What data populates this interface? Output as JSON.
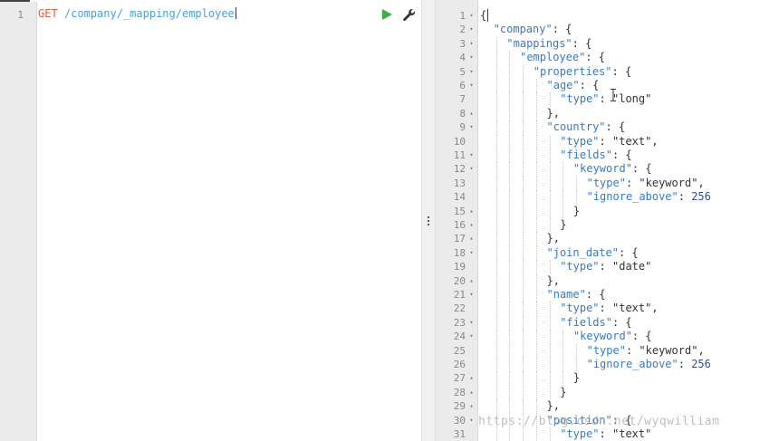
{
  "request": {
    "line_number": "1",
    "method": "GET",
    "path": "/company/_mapping/employee"
  },
  "actions": {
    "run_icon": "play-icon",
    "settings_icon": "wrench-icon"
  },
  "response": {
    "lines": [
      {
        "n": "1",
        "f": "▾",
        "d": 0,
        "parts": [
          [
            "p",
            "{"
          ]
        ]
      },
      {
        "n": "2",
        "f": "▾",
        "d": 1,
        "parts": [
          [
            "k",
            "\"company\""
          ],
          [
            "p",
            ": {"
          ]
        ]
      },
      {
        "n": "3",
        "f": "▾",
        "d": 2,
        "parts": [
          [
            "k",
            "\"mappings\""
          ],
          [
            "p",
            ": {"
          ]
        ]
      },
      {
        "n": "4",
        "f": "▾",
        "d": 3,
        "parts": [
          [
            "k",
            "\"employee\""
          ],
          [
            "p",
            ": {"
          ]
        ]
      },
      {
        "n": "5",
        "f": "▾",
        "d": 4,
        "parts": [
          [
            "k",
            "\"properties\""
          ],
          [
            "p",
            ": {"
          ]
        ]
      },
      {
        "n": "6",
        "f": "▾",
        "d": 5,
        "parts": [
          [
            "k",
            "\"age\""
          ],
          [
            "p",
            ": {"
          ]
        ]
      },
      {
        "n": "7",
        "f": "",
        "d": 6,
        "parts": [
          [
            "k",
            "\"type\""
          ],
          [
            "p",
            ": "
          ],
          [
            "s",
            "\"long\""
          ]
        ]
      },
      {
        "n": "8",
        "f": "▴",
        "d": 5,
        "parts": [
          [
            "p",
            "},"
          ]
        ]
      },
      {
        "n": "9",
        "f": "▾",
        "d": 5,
        "parts": [
          [
            "k",
            "\"country\""
          ],
          [
            "p",
            ": {"
          ]
        ]
      },
      {
        "n": "10",
        "f": "",
        "d": 6,
        "parts": [
          [
            "k",
            "\"type\""
          ],
          [
            "p",
            ": "
          ],
          [
            "s",
            "\"text\""
          ],
          [
            "p",
            ","
          ]
        ]
      },
      {
        "n": "11",
        "f": "▾",
        "d": 6,
        "parts": [
          [
            "k",
            "\"fields\""
          ],
          [
            "p",
            ": {"
          ]
        ]
      },
      {
        "n": "12",
        "f": "▾",
        "d": 7,
        "parts": [
          [
            "k",
            "\"keyword\""
          ],
          [
            "p",
            ": {"
          ]
        ]
      },
      {
        "n": "13",
        "f": "",
        "d": 8,
        "parts": [
          [
            "k",
            "\"type\""
          ],
          [
            "p",
            ": "
          ],
          [
            "s",
            "\"keyword\""
          ],
          [
            "p",
            ","
          ]
        ]
      },
      {
        "n": "14",
        "f": "",
        "d": 8,
        "parts": [
          [
            "k",
            "\"ignore_above\""
          ],
          [
            "p",
            ": "
          ],
          [
            "n",
            "256"
          ]
        ]
      },
      {
        "n": "15",
        "f": "▴",
        "d": 7,
        "parts": [
          [
            "p",
            "}"
          ]
        ]
      },
      {
        "n": "16",
        "f": "▴",
        "d": 6,
        "parts": [
          [
            "p",
            "}"
          ]
        ]
      },
      {
        "n": "17",
        "f": "▴",
        "d": 5,
        "parts": [
          [
            "p",
            "},"
          ]
        ]
      },
      {
        "n": "18",
        "f": "▾",
        "d": 5,
        "parts": [
          [
            "k",
            "\"join_date\""
          ],
          [
            "p",
            ": {"
          ]
        ]
      },
      {
        "n": "19",
        "f": "",
        "d": 6,
        "parts": [
          [
            "k",
            "\"type\""
          ],
          [
            "p",
            ": "
          ],
          [
            "s",
            "\"date\""
          ]
        ]
      },
      {
        "n": "20",
        "f": "▴",
        "d": 5,
        "parts": [
          [
            "p",
            "},"
          ]
        ]
      },
      {
        "n": "21",
        "f": "▾",
        "d": 5,
        "parts": [
          [
            "k",
            "\"name\""
          ],
          [
            "p",
            ": {"
          ]
        ]
      },
      {
        "n": "22",
        "f": "",
        "d": 6,
        "parts": [
          [
            "k",
            "\"type\""
          ],
          [
            "p",
            ": "
          ],
          [
            "s",
            "\"text\""
          ],
          [
            "p",
            ","
          ]
        ]
      },
      {
        "n": "23",
        "f": "▾",
        "d": 6,
        "parts": [
          [
            "k",
            "\"fields\""
          ],
          [
            "p",
            ": {"
          ]
        ]
      },
      {
        "n": "24",
        "f": "▾",
        "d": 7,
        "parts": [
          [
            "k",
            "\"keyword\""
          ],
          [
            "p",
            ": {"
          ]
        ]
      },
      {
        "n": "25",
        "f": "",
        "d": 8,
        "parts": [
          [
            "k",
            "\"type\""
          ],
          [
            "p",
            ": "
          ],
          [
            "s",
            "\"keyword\""
          ],
          [
            "p",
            ","
          ]
        ]
      },
      {
        "n": "26",
        "f": "",
        "d": 8,
        "parts": [
          [
            "k",
            "\"ignore_above\""
          ],
          [
            "p",
            ": "
          ],
          [
            "n",
            "256"
          ]
        ]
      },
      {
        "n": "27",
        "f": "▴",
        "d": 7,
        "parts": [
          [
            "p",
            "}"
          ]
        ]
      },
      {
        "n": "28",
        "f": "▴",
        "d": 6,
        "parts": [
          [
            "p",
            "}"
          ]
        ]
      },
      {
        "n": "29",
        "f": "▴",
        "d": 5,
        "parts": [
          [
            "p",
            "},"
          ]
        ]
      },
      {
        "n": "30",
        "f": "▾",
        "d": 5,
        "parts": [
          [
            "k",
            "\"position\""
          ],
          [
            "p",
            ": {"
          ]
        ]
      },
      {
        "n": "31",
        "f": "",
        "d": 6,
        "parts": [
          [
            "k",
            "\"type\""
          ],
          [
            "p",
            ": "
          ],
          [
            "s",
            "\"text\""
          ]
        ]
      }
    ]
  },
  "watermark": "https://blog.csdn.net/wyqwilliam"
}
